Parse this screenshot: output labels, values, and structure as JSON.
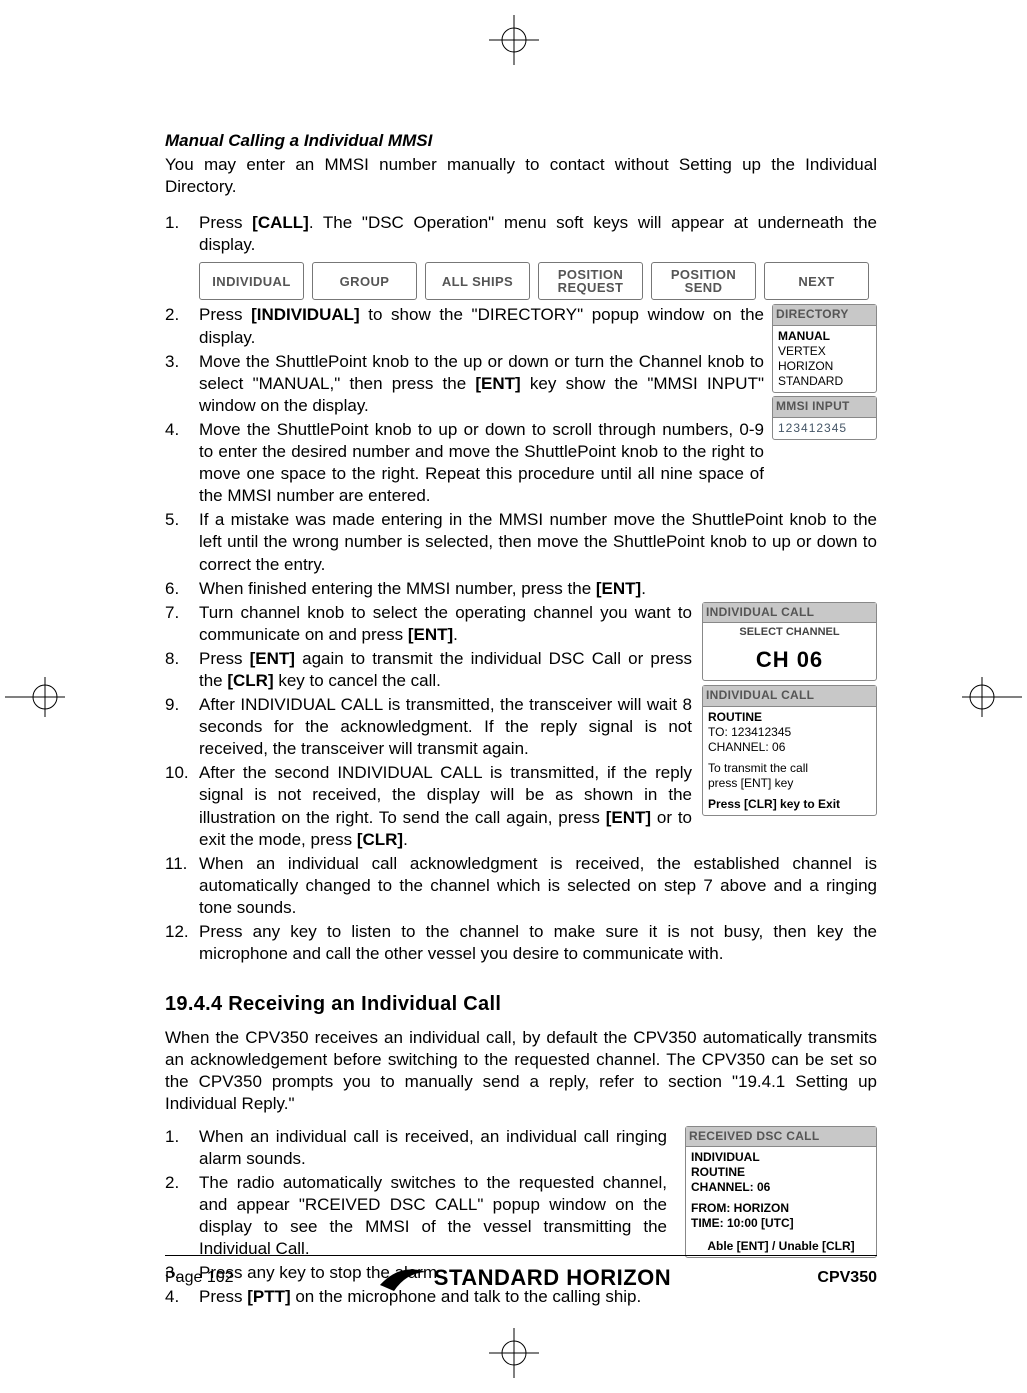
{
  "section_title": "Manual Calling a Individual MMSI",
  "intro": "You may enter an MMSI number manually to contact without Setting up the Individual Directory.",
  "step1_pre": "Press ",
  "step1_b": "[CALL]",
  "step1_post": ". The \"DSC Operation\" menu  soft keys will appear at underneath the display.",
  "softkeys": {
    "k1": "INDIVIDUAL",
    "k2": "GROUP",
    "k3": "ALL SHIPS",
    "k4a": "POSITION",
    "k4b": "REQUEST",
    "k5a": "POSITION",
    "k5b": "SEND",
    "k6": "NEXT"
  },
  "step2_pre": "Press ",
  "step2_b": "[INDIVIDUAL]",
  "step2_post": " to show the \"DIRECTORY\" popup window on the display.",
  "step3_a": "Move the ShuttlePoint knob to the up or down or turn the Channel knob to select \"MANUAL,\" then press the ",
  "step3_b": "[ENT]",
  "step3_c": " key show the \"MMSI INPUT\" window on the display.",
  "step4": "Move the ShuttlePoint knob to up or down to scroll through numbers, 0-9 to enter the desired number and move the ShuttlePoint knob to the right to move one space to the right. Repeat this procedure until all nine space of the MMSI number are entered.",
  "step5": "If a mistake was made entering in the MMSI number move the ShuttlePoint knob to the left until the wrong number is selected, then move the ShuttlePoint knob to up or down to correct the entry.",
  "step6_a": "When finished entering the MMSI number, press the ",
  "step6_b": "[ENT]",
  "step6_c": ".",
  "step7_a": "Turn channel knob to select the operating channel you want to communicate on and press ",
  "step7_b": "[ENT]",
  "step7_c": ".",
  "step8_a": "Press ",
  "step8_b1": "[ENT]",
  "step8_mid": " again to transmit the individual DSC Call or press the ",
  "step8_b2": "[CLR]",
  "step8_c": " key to cancel the call.",
  "step9": "After INDIVIDUAL CALL is transmitted, the transceiver will wait 8 seconds for the acknowledgment. If the reply signal is not received, the transceiver will transmit again.",
  "step10_a": "After the second INDIVIDUAL CALL is transmitted, if the reply signal is not received, the display will be as shown in the illustration on the right. To send the call again, press ",
  "step10_b1": "[ENT]",
  "step10_mid": " or to exit the mode, press ",
  "step10_b2": "[CLR]",
  "step10_c": ".",
  "step11": "When an individual call acknowledgment is received, the established channel is automatically changed to the channel which is selected on step 7 above and a ringing tone sounds.",
  "step12": "Press any key to listen to the channel to make sure it is not busy, then key the microphone and call the other vessel you desire to communicate with.",
  "num1": "1.",
  "num2": "2.",
  "num3": "3.",
  "num4": "4.",
  "num5": "5.",
  "num6": "6.",
  "num7": "7.",
  "num8": "8.",
  "num9": "9.",
  "num10": "10.",
  "num11": "11.",
  "num12": "12.",
  "dir_popup": {
    "hdr": "DIRECTORY",
    "l1": "MANUAL",
    "l2": "VERTEX",
    "l3": "HORIZON",
    "l4": "STANDARD"
  },
  "mmsi_popup": {
    "hdr": "MMSI INPUT",
    "val": "123412345"
  },
  "indcall1": {
    "hdr": "INDIVIDUAL CALL",
    "sub": "SELECT CHANNEL",
    "ch": "CH 06"
  },
  "indcall2": {
    "hdr": "INDIVIDUAL CALL",
    "l1": "ROUTINE",
    "l2": "TO: 123412345",
    "l3": "CHANNEL: 06",
    "l4": "To transmit the call",
    "l5": "press [ENT] key",
    "l6": "Press [CLR] key to Exit"
  },
  "h2": "19.4.4 Receiving an Individual Call",
  "body2": "When the CPV350 receives an individual call, by default the CPV350 automatically transmits an acknowledgement before switching to the requested channel. The CPV350 can be set so the CPV350 prompts you to manually send a reply, refer to section \"19.4.1 Setting up Individual Reply.\"",
  "s2_1": "When an individual call is received, an individual call ringing alarm sounds.",
  "s2_2": "The radio automatically switches to the requested channel, and appear \"RCEIVED DSC CALL\" popup window on the display to see the MMSI of the vessel transmitting the Individual Call.",
  "s2_3": "Press any key to stop the alarm.",
  "s2_4a": "Press ",
  "s2_4b": "[PTT]",
  "s2_4c": " on the microphone and talk to the calling ship.",
  "recv_popup": {
    "hdr": "RECEIVED DSC CALL",
    "l1": "INDIVIDUAL",
    "l2": "ROUTINE",
    "l3": "CHANNEL: 06",
    "l4": "FROM: HORIZON",
    "l5": "TIME: 10:00 [UTC]",
    "l6": "Able [ENT] / Unable [CLR]"
  },
  "footer": {
    "page": "Page 102",
    "brand": "STANDARD HORIZON",
    "model": "CPV350"
  }
}
